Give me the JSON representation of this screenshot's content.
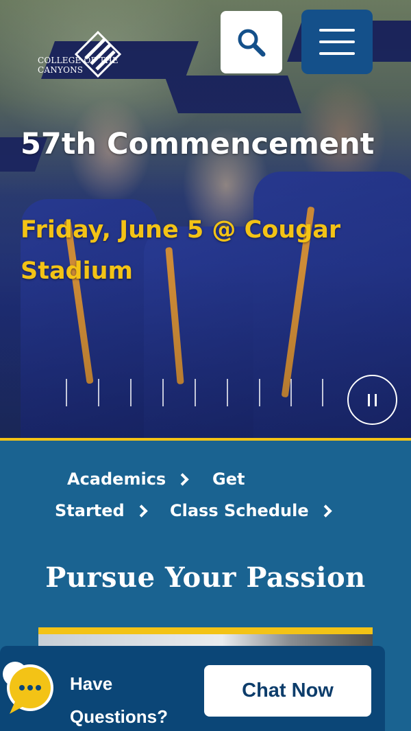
{
  "header": {
    "logo_text": "COLLEGE OF THE CANYONS",
    "search_icon": "search-icon",
    "menu_icon": "hamburger-menu-icon"
  },
  "hero": {
    "title": "57th Commencement",
    "subtitle": "Friday, June 5 @ Cougar Stadium",
    "slide_count": 9,
    "pause_icon": "pause-icon"
  },
  "quick_links": [
    {
      "label": "Academics"
    },
    {
      "label": "Get Started"
    },
    {
      "label": "Class Schedule"
    }
  ],
  "section": {
    "title": "Pursue Your Passion"
  },
  "chat": {
    "prompt": "Have Questions?",
    "prompt_line1": "Have",
    "prompt_line2": "Questions?",
    "button_label": "Chat Now",
    "icon": "chat-bubble-icon"
  },
  "colors": {
    "brand_blue": "#14508a",
    "section_blue": "#1a6391",
    "chat_blue": "#0b4677",
    "accent_gold": "#f3c316"
  }
}
